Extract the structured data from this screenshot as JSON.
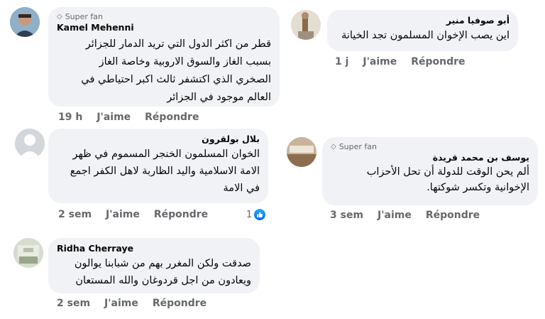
{
  "comments": [
    {
      "author": "Kamel Mehenni",
      "badge": "Super fan",
      "text": "قطر من اكثر الدول التي تريد الدمار للجزائر\nبسبب الغاز والسوق الاروبية وخاصة الغاز\nالصخري الذي اكتشفر ثالث اكبر احتياطي في\nالعالم موجود في الجزائر",
      "time": "19 h",
      "like": "J'aime",
      "reply": "Répondre"
    },
    {
      "author": "أبو صوفيا منير",
      "text": "اين يصب الإخوان المسلمون  تجد الخيانة",
      "time": "1 j",
      "like": "J'aime",
      "reply": "Répondre"
    },
    {
      "author": "بلال بولقرون",
      "text": "الخوان المسلمون الخنجر المسموم في ظهر\nالامة الاسلامية واليد الظاربة لاهل الكفر اجمع\nفي الامة",
      "time": "2 sem",
      "like": "J'aime",
      "reply": "Répondre",
      "reaction_count": "1"
    },
    {
      "author": "يوسف بن محمد قريدة",
      "badge": "Super fan",
      "text": "ألم يحن الوقت للدولة أن تحل الأحزاب\nالإخوانية وتكسر شوكتها.",
      "time": "3 sem",
      "like": "J'aime",
      "reply": "Répondre"
    },
    {
      "author": "Ridha Cherraye",
      "text": "صدقت ولكن المغرر بهم من شبابنا يوالون\nويعادون من اجل قردوغان والله المستعان",
      "time": "2 sem",
      "like": "J'aime",
      "reply": "Répondre"
    }
  ],
  "colors": {
    "bubble": "#f0f2f5",
    "meta": "#65676b",
    "like_blue": "#0866ff"
  },
  "icons": [
    "super-fan-icon",
    "like-reaction-icon",
    "default-avatar-icon"
  ]
}
